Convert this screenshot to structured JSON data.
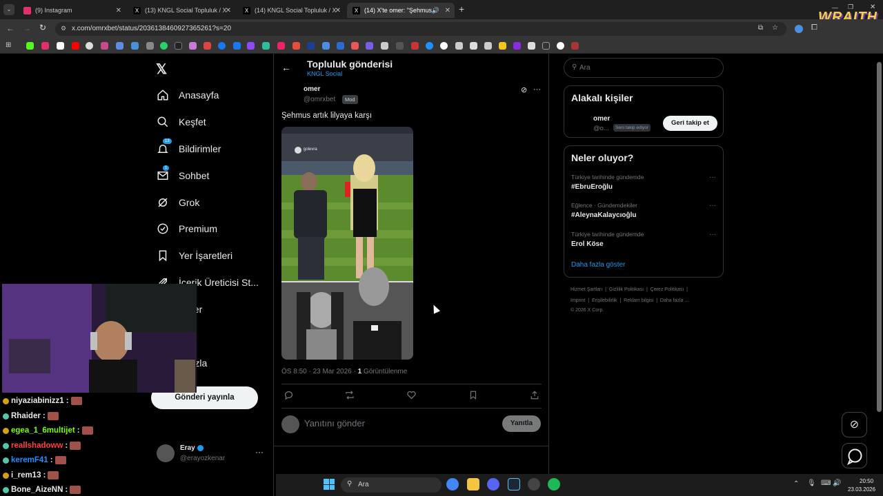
{
  "browser": {
    "tabs": [
      {
        "title": "(9) Instagram",
        "color": "#e1306c",
        "active": false
      },
      {
        "title": "(13) KNGL Social Topluluk / X",
        "color": "#ffffff",
        "active": false
      },
      {
        "title": "(14) KNGL Social Topluluk / X",
        "color": "#ffffff",
        "active": false
      },
      {
        "title": "(14) X'te omer: \"Şehmus artı",
        "color": "#ffffff",
        "active": true
      }
    ],
    "url": "x.com/omrxbet/status/2036138460927365261?s=20",
    "overlay_logo": "WRAITH"
  },
  "sidebar": {
    "items": [
      {
        "label": "Anasayfa",
        "icon": "home-icon"
      },
      {
        "label": "Keşfet",
        "icon": "search-icon"
      },
      {
        "label": "Bildirimler",
        "icon": "bell-icon",
        "badge": "13"
      },
      {
        "label": "Sohbet",
        "icon": "mail-icon",
        "badge": "1"
      },
      {
        "label": "Grok",
        "icon": "grok-icon"
      },
      {
        "label": "Premium",
        "icon": "verified-icon"
      },
      {
        "label": "Yer İşaretleri",
        "icon": "bookmark-icon"
      },
      {
        "label": "İçerik Üreticisi St...",
        "icon": "rocket-icon"
      },
      {
        "label": "aleler",
        "icon": "article-icon"
      },
      {
        "label": "l",
        "icon": "profile-icon"
      },
      {
        "label": "a fazla",
        "icon": "more-icon"
      }
    ],
    "post_button": "Gönderi yayınla",
    "account": {
      "name": "Eray",
      "handle": "@erayozkenar"
    }
  },
  "post": {
    "header_title": "Topluluk gönderisi",
    "community": "KNGL Social",
    "author_name": "omer",
    "author_handle": "@omrxbet",
    "role_badge": "Mod",
    "text": "Şehmus artık lilyaya karşı",
    "time": "ÖS 8:50 · 23 Mar 2026 ·",
    "views_count": "1",
    "views_label": "Görüntülenme",
    "reply_placeholder": "Yanıtını gönder",
    "reply_button": "Yanıtla",
    "image_watermark": "golevra"
  },
  "right": {
    "search_placeholder": "Ara",
    "related_title": "Alakalı kişiler",
    "related_person": {
      "name": "omer",
      "handle": "@o...",
      "follows_you": "Seni takip ediyor",
      "button": "Geri takip et"
    },
    "trends_title": "Neler oluyor?",
    "trends": [
      {
        "category": "Türkiye tarihinde gündemde",
        "name": "#EbruEroğlu"
      },
      {
        "category": "Eğlence · Gündemdekiler",
        "name": "#AleynaKalaycıoğlu"
      },
      {
        "category": "Türkiye tarihinde gündemde",
        "name": "Erol Köse"
      }
    ],
    "show_more": "Daha fazla göster",
    "footer_line1": "Hizmet Şartları  |  Gizlilik Politikası  |  Çerez Politikası  |",
    "footer_line2": "Imprint  |  Erişilebilirlik  |  Reklam bilgisi  |  Daha fazla ...",
    "footer_line3": "© 2026 X Corp."
  },
  "chat": [
    {
      "user": "niyaziabinizz1",
      "color": "#e7e9ea",
      "badge": "#d4a017"
    },
    {
      "user": "Rhaider",
      "color": "#e7e9ea",
      "badge": "#53c7a8"
    },
    {
      "user": "egea_1_6multijet",
      "color": "#7cfc00",
      "badge": "#d4a017"
    },
    {
      "user": "reallshadoww",
      "color": "#ff4040",
      "badge": "#53c7a8"
    },
    {
      "user": "keremF41",
      "color": "#1e90ff",
      "badge": "#53c7a8"
    },
    {
      "user": "i_rem13",
      "color": "#e7e9ea",
      "badge": "#d4a017"
    },
    {
      "user": "Bone_AizeNN",
      "color": "#e7e9ea",
      "badge": "#53c7a8"
    }
  ],
  "taskbar": {
    "search": "Ara",
    "time": "20:50",
    "date": "23.03.2026"
  }
}
